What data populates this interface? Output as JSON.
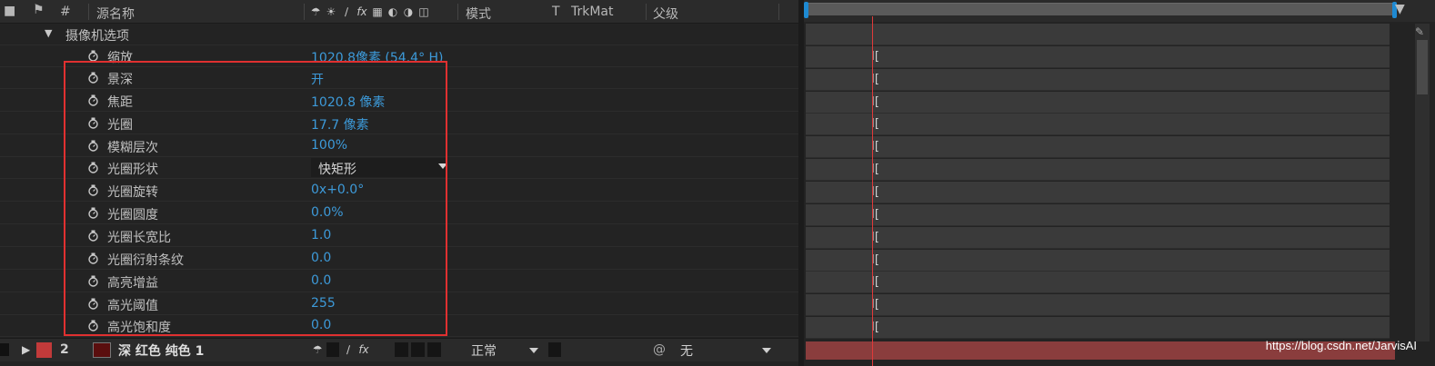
{
  "header": {
    "hash": "#",
    "source_name": "源名称",
    "mode": "模式",
    "t": "T",
    "trkmat": "TrkMat",
    "parent": "父级"
  },
  "camera_group": {
    "label": "摄像机选项",
    "zoom_name": "缩放",
    "zoom_value": "1020.8像素 (54.4° H)"
  },
  "properties": [
    {
      "name": "景深",
      "value": "开"
    },
    {
      "name": "焦距",
      "value": "1020.8 像素"
    },
    {
      "name": "光圈",
      "value": "17.7 像素"
    },
    {
      "name": "模糊层次",
      "value": "100%"
    },
    {
      "name": "光圈形状",
      "value": "快矩形",
      "dropdown": true
    },
    {
      "name": "光圈旋转",
      "value": "0x+0.0°"
    },
    {
      "name": "光圈圆度",
      "value": "0.0%"
    },
    {
      "name": "光圈长宽比",
      "value": "1.0"
    },
    {
      "name": "光圈衍射条纹",
      "value": "0.0"
    },
    {
      "name": "高亮增益",
      "value": "0.0"
    },
    {
      "name": "高光阈值",
      "value": "255"
    },
    {
      "name": "高光饱和度",
      "value": "0.0"
    }
  ],
  "layer": {
    "number": "2",
    "name": "深 红色 纯色 1",
    "mode": "正常",
    "parent": "无",
    "label_color": "#c23a3a",
    "bar_color": "#8a3d3d"
  },
  "colors": {
    "accent": "#3d9ad9",
    "highlight_box": "#e03030",
    "playhead": "#e03a3a",
    "work_area_caps": "#1e8ad2"
  },
  "watermark": "https://blog.csdn.net/JarvisAI"
}
